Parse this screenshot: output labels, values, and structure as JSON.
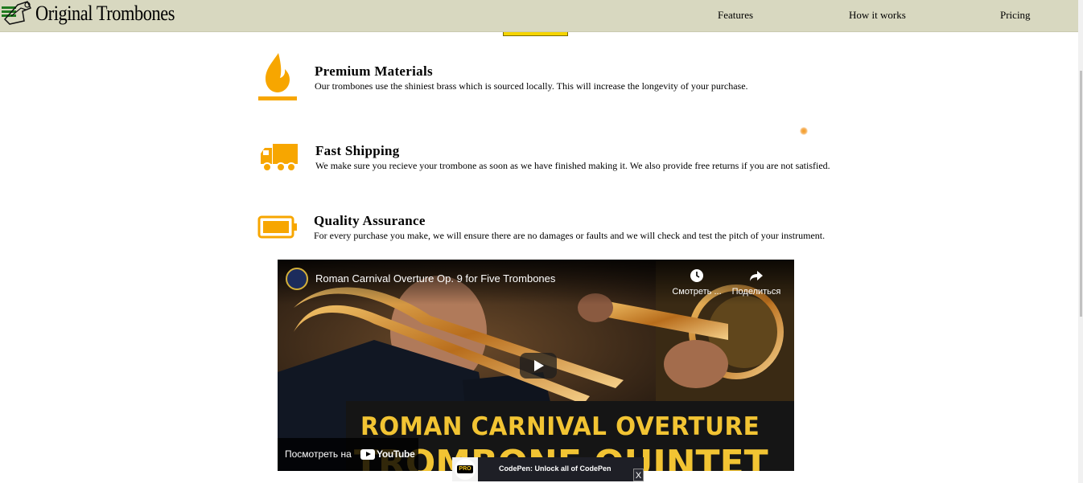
{
  "header": {
    "logo_text": "Original Trombones",
    "nav": [
      {
        "label": "Features"
      },
      {
        "label": "How it works"
      },
      {
        "label": "Pricing"
      }
    ]
  },
  "features": [
    {
      "icon": "flame-icon",
      "title": "Premium Materials",
      "text": "Our trombones use the shiniest brass which is sourced locally. This will increase the longevity of your purchase."
    },
    {
      "icon": "truck-icon",
      "title": "Fast Shipping",
      "text": "We make sure you recieve your trombone as soon as we have finished making it. We also provide free returns if you are not satisfied."
    },
    {
      "icon": "battery-icon",
      "title": "Quality Assurance",
      "text": "For every purchase you make, we will ensure there are no damages or faults and we will check and test the pitch of your instrument."
    }
  ],
  "video": {
    "title": "Roman Carnival Overture Op. 9 for Five Trombones",
    "watch_later_label": "Смотреть ...",
    "share_label": "Поделиться",
    "banner_line1": "ROMAN CARNIVAL OVERTURE",
    "banner_line2": "TROMBONE QUINTET",
    "watch_on_label": "Посмотреть на",
    "youtube_label": "YouTube"
  },
  "promo": {
    "badge": "PRO",
    "text": "CodePen: Unlock all of CodePen",
    "close": "X"
  },
  "colors": {
    "header_bg": "#d8d8c0",
    "accent": "#f7a600",
    "banner_text": "#f2c433"
  }
}
